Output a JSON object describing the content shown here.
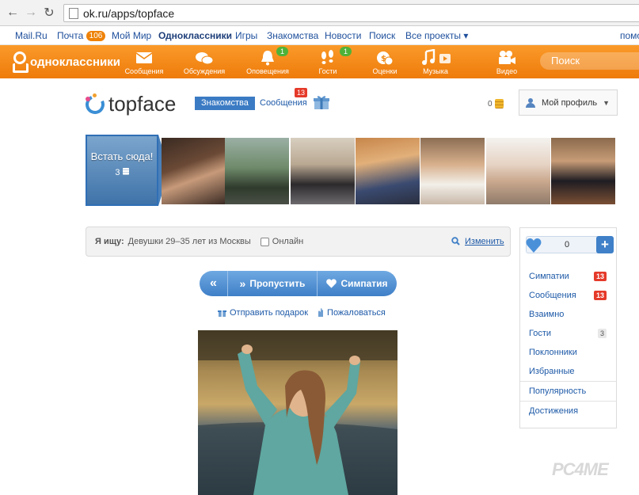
{
  "browser": {
    "url": "ok.ru/apps/topface"
  },
  "portal": {
    "links": [
      "Mail.Ru",
      "Почта",
      "Мой Мир",
      "Одноклассники",
      "Игры",
      "Знакомства",
      "Новости",
      "Поиск",
      "Все проекты ▾",
      "помо"
    ],
    "mail_badge": "106"
  },
  "ok_toolbar": {
    "brand": "одноклассники",
    "items": [
      {
        "label": "Сообщения",
        "icon": "envelope-icon"
      },
      {
        "label": "Обсуждения",
        "icon": "chat-bubbles-icon"
      },
      {
        "label": "Оповещения",
        "icon": "bell-icon",
        "badge": "1"
      },
      {
        "label": "Гости",
        "icon": "footprints-icon",
        "badge": "1"
      },
      {
        "label": "Оценки",
        "icon": "rating-icon"
      },
      {
        "label": "Музыка",
        "icon": "music-note-icon"
      },
      {
        "label": "Видео",
        "icon": "video-camera-icon"
      }
    ],
    "search_placeholder": "Поиск"
  },
  "app_header": {
    "logo_text": "topface",
    "dating_label": "Знакомства",
    "messages_label": "Сообщения",
    "messages_badge": "13",
    "coins": "0",
    "profile_label": "Мой профиль"
  },
  "photo_strip": {
    "stand_here_label": "Встать сюда!",
    "stand_here_cost": "3"
  },
  "search": {
    "label": "Я ищу:",
    "criteria": "Девушки  29–35 лет из Москвы",
    "online_label": "Онлайн",
    "change_label": "Изменить"
  },
  "actions": {
    "back_label": "«",
    "skip_label": "Пропустить",
    "like_label": "Симпатия",
    "gift_label": "Отправить подарок",
    "report_label": "Пожаловаться"
  },
  "sidebar": {
    "likes_count": "0",
    "menu": [
      {
        "label": "Симпатии",
        "count": "13",
        "style": "red"
      },
      {
        "label": "Сообщения",
        "count": "13",
        "style": "red"
      },
      {
        "label": "Взаимно",
        "count": "",
        "style": ""
      },
      {
        "label": "Гости",
        "count": "3",
        "style": "grey"
      },
      {
        "label": "Поклонники",
        "count": "",
        "style": ""
      },
      {
        "label": "Избранные",
        "count": "",
        "style": ""
      },
      {
        "label": "Популярность",
        "count": "",
        "style": ""
      },
      {
        "label": "Достижения",
        "count": "",
        "style": ""
      }
    ]
  },
  "watermark": "PC4ME"
}
